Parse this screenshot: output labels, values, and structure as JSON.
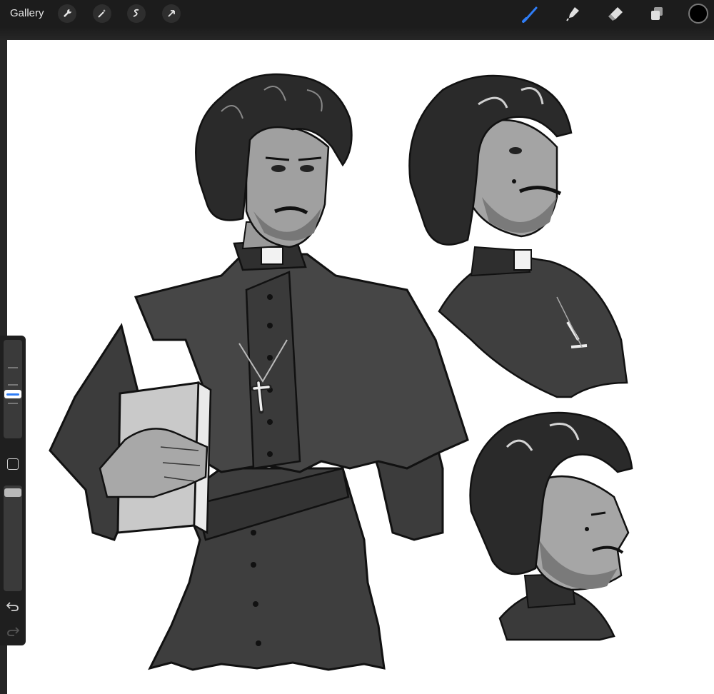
{
  "toolbar": {
    "gallery_label": "Gallery",
    "actions": [
      {
        "name": "actions-wrench-icon"
      },
      {
        "name": "adjustments-wand-icon"
      },
      {
        "name": "selection-icon"
      },
      {
        "name": "transform-arrow-icon"
      }
    ],
    "tools": [
      {
        "name": "brush-icon",
        "active": true
      },
      {
        "name": "smudge-icon",
        "active": false
      },
      {
        "name": "eraser-icon",
        "active": false
      },
      {
        "name": "layers-icon",
        "active": false
      }
    ],
    "current_color": "#000000",
    "accent_color": "#2f7df6"
  },
  "sidebar": {
    "brush_size_level": 0.6,
    "opacity_level": 1.0
  }
}
